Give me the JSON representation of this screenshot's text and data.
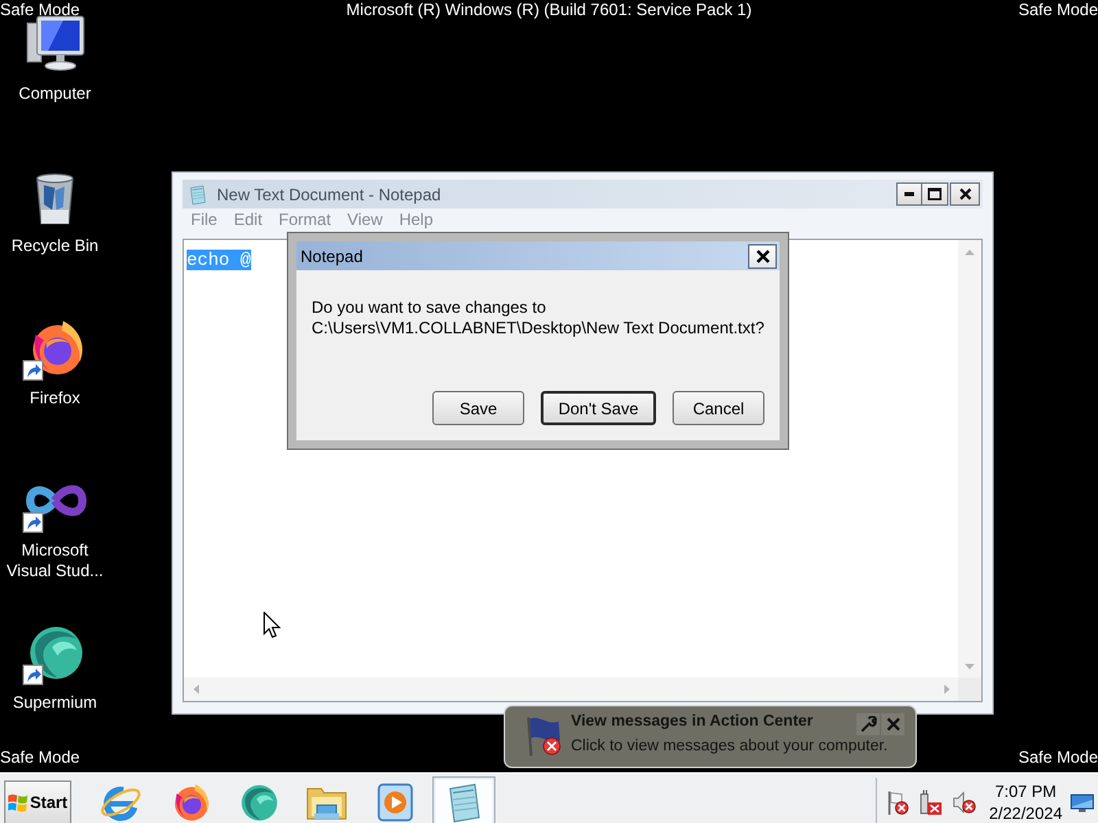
{
  "top_bar": {
    "left": "Safe Mode",
    "title": "Microsoft (R) Windows (R) (Build 7601: Service Pack 1)",
    "right": "Safe Mode"
  },
  "desktop_icons": [
    {
      "kind": "computer",
      "label": "Computer",
      "shortcut": false
    },
    {
      "kind": "recycle-bin",
      "label": "Recycle Bin",
      "shortcut": false
    },
    {
      "kind": "firefox",
      "label": "Firefox",
      "shortcut": true
    },
    {
      "kind": "visual-studio",
      "label": "Microsoft Visual Stud...",
      "shortcut": true
    },
    {
      "kind": "supermium",
      "label": "Supermium",
      "shortcut": true
    }
  ],
  "notepad": {
    "title": "New Text Document - Notepad",
    "menu": [
      {
        "label": "File",
        "disabled": true
      },
      {
        "label": "Edit",
        "disabled": true
      },
      {
        "label": "Format",
        "disabled": true
      },
      {
        "label": "View",
        "disabled": true
      },
      {
        "label": "Help",
        "disabled": true
      }
    ],
    "content": "echo @",
    "content_selected": true
  },
  "dialog": {
    "title": "Notepad",
    "message": "Do you want to save changes to\nC:\\Users\\VM1.COLLABNET\\Desktop\\New Text Document.txt?",
    "buttons": [
      {
        "label": "Save",
        "default": false
      },
      {
        "label": "Don't Save",
        "default": true
      },
      {
        "label": "Cancel",
        "default": false
      }
    ]
  },
  "balloon": {
    "title": "View messages in Action Center",
    "text": "Click to view messages about your computer."
  },
  "bottom_bar": {
    "left": "Safe Mode",
    "right": "Safe Mode"
  },
  "taskbar": {
    "start_label": "Start",
    "apps": [
      {
        "kind": "internet-explorer",
        "active": false
      },
      {
        "kind": "firefox",
        "active": false
      },
      {
        "kind": "supermium",
        "active": false
      },
      {
        "kind": "file-explorer",
        "active": false
      },
      {
        "kind": "media-player",
        "active": false
      },
      {
        "kind": "notepad",
        "active": true
      }
    ],
    "tray_icons": [
      {
        "kind": "action-center"
      },
      {
        "kind": "network"
      },
      {
        "kind": "volume"
      }
    ],
    "clock": {
      "time": "7:07 PM",
      "date": "2/22/2024"
    }
  }
}
